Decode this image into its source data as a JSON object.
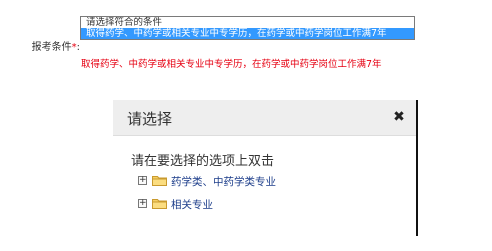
{
  "form": {
    "label": "报考条件",
    "required_mark": "*",
    "label_suffix": ":",
    "select": {
      "placeholder_option": "请选择符合的条件",
      "selected_option": "取得药学、中药学或相关专业中专学历，在药学或中药学岗位工作满7年"
    },
    "hint": "取得药学、中药学或相关专业中专学历，在药学或中药学岗位工作满7年"
  },
  "dialog": {
    "title": "请选择",
    "close_icon": "close-icon",
    "instruction": "请在要选择的选项上双击",
    "tree": [
      {
        "label": "药学类、中药学类专业",
        "expander": "+",
        "icon": "folder-icon"
      },
      {
        "label": "相关专业",
        "expander": "+",
        "icon": "folder-icon"
      }
    ]
  },
  "colors": {
    "required": "#e60012",
    "selection_bg": "#3399ff",
    "tree_link": "#1c3d8a",
    "dialog_header_bg": "#eeeeee"
  }
}
